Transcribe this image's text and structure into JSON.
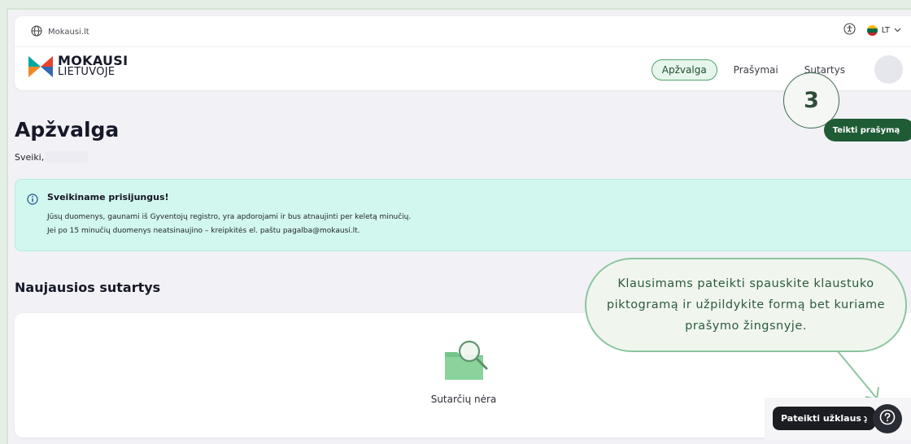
{
  "topbar": {
    "site_label": "Mokausi.lt",
    "language": "LT",
    "flag_colors": [
      "#fdb913",
      "#006a44",
      "#c1272d"
    ]
  },
  "logo": {
    "line1": "MOKAUSI",
    "line2": "LIETUVOJE"
  },
  "nav": {
    "items": [
      {
        "label": "Apžvalga",
        "active": true
      },
      {
        "label": "Prašymai",
        "active": false
      },
      {
        "label": "Sutartys",
        "active": false
      }
    ]
  },
  "step_badge": "3",
  "main": {
    "title": "Apžvalga",
    "greeting": "Sveiki,",
    "submit_button": "Teikti prašymą"
  },
  "info": {
    "title": "Sveikiname prisijungus!",
    "line1": "Jūsų duomenys, gaunami iš Gyventojų registro, yra apdorojami ir bus atnaujinti per keletą minučių.",
    "line2": "Jei po 15 minučių duomenys neatsinaujino – kreipkitės el. paštu pagalba@mokausi.lt."
  },
  "contracts": {
    "section_title": "Naujausios sutartys",
    "empty_text": "Sutarčių nėra"
  },
  "tooltip": {
    "text": "Klausimams pateikti spauskite klaustuko piktogramą ir užpildykite formą bet kuriame prašymo žingsnyje."
  },
  "help": {
    "label": "Pateikti užklausą",
    "icon": "question-icon"
  },
  "colors": {
    "accent": "#1f5c36",
    "info_bg": "#d2f7ef",
    "tooltip_border": "#8cc5a0"
  }
}
